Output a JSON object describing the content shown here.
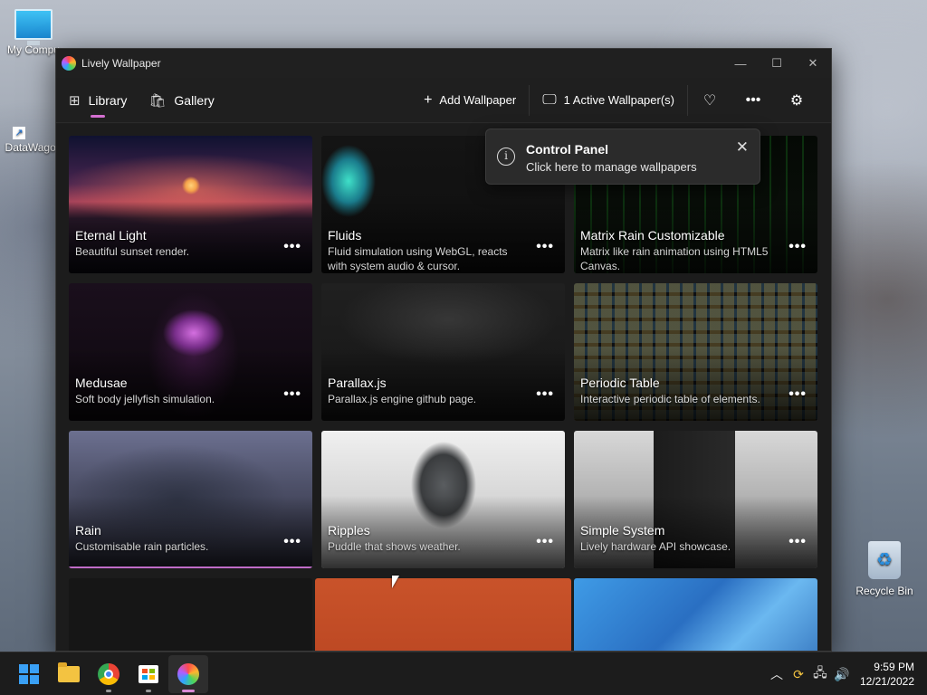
{
  "desktop": {
    "icons": [
      {
        "label": "My Compu"
      },
      {
        "label": "DataWagon"
      },
      {
        "label": "Recycle Bin"
      }
    ]
  },
  "window": {
    "title": "Lively Wallpaper"
  },
  "nav": {
    "tabs": [
      {
        "label": "Library",
        "icon": "grid-icon",
        "active": true
      },
      {
        "label": "Gallery",
        "icon": "bag-icon",
        "active": false
      }
    ],
    "add_wallpaper": "Add Wallpaper",
    "active_wallpapers": "1 Active Wallpaper(s)"
  },
  "toast": {
    "title": "Control Panel",
    "subtitle": "Click here to manage wallpapers"
  },
  "wallpapers": [
    {
      "title": "Eternal Light",
      "description": "Beautiful sunset render."
    },
    {
      "title": "Fluids",
      "description": "Fluid simulation using WebGL, reacts with system audio & cursor."
    },
    {
      "title": "Matrix Rain Customizable",
      "description": "Matrix like rain animation using HTML5 Canvas."
    },
    {
      "title": "Medusae",
      "description": "Soft body jellyfish simulation."
    },
    {
      "title": "Parallax.js",
      "description": "Parallax.js engine github page."
    },
    {
      "title": "Periodic Table",
      "description": "Interactive periodic table of elements."
    },
    {
      "title": "Rain",
      "description": "Customisable rain particles.",
      "selected": true
    },
    {
      "title": "Ripples",
      "description": "Puddle that shows weather."
    },
    {
      "title": "Simple System",
      "description": "Lively hardware API showcase."
    }
  ],
  "more_glyph": "•••",
  "taskbar": {
    "time": "9:59 PM",
    "date": "12/21/2022"
  },
  "colors": {
    "accent": "#d46fd1",
    "window_bg": "#1e1e1e",
    "toast_bg": "#2b2b2b"
  }
}
